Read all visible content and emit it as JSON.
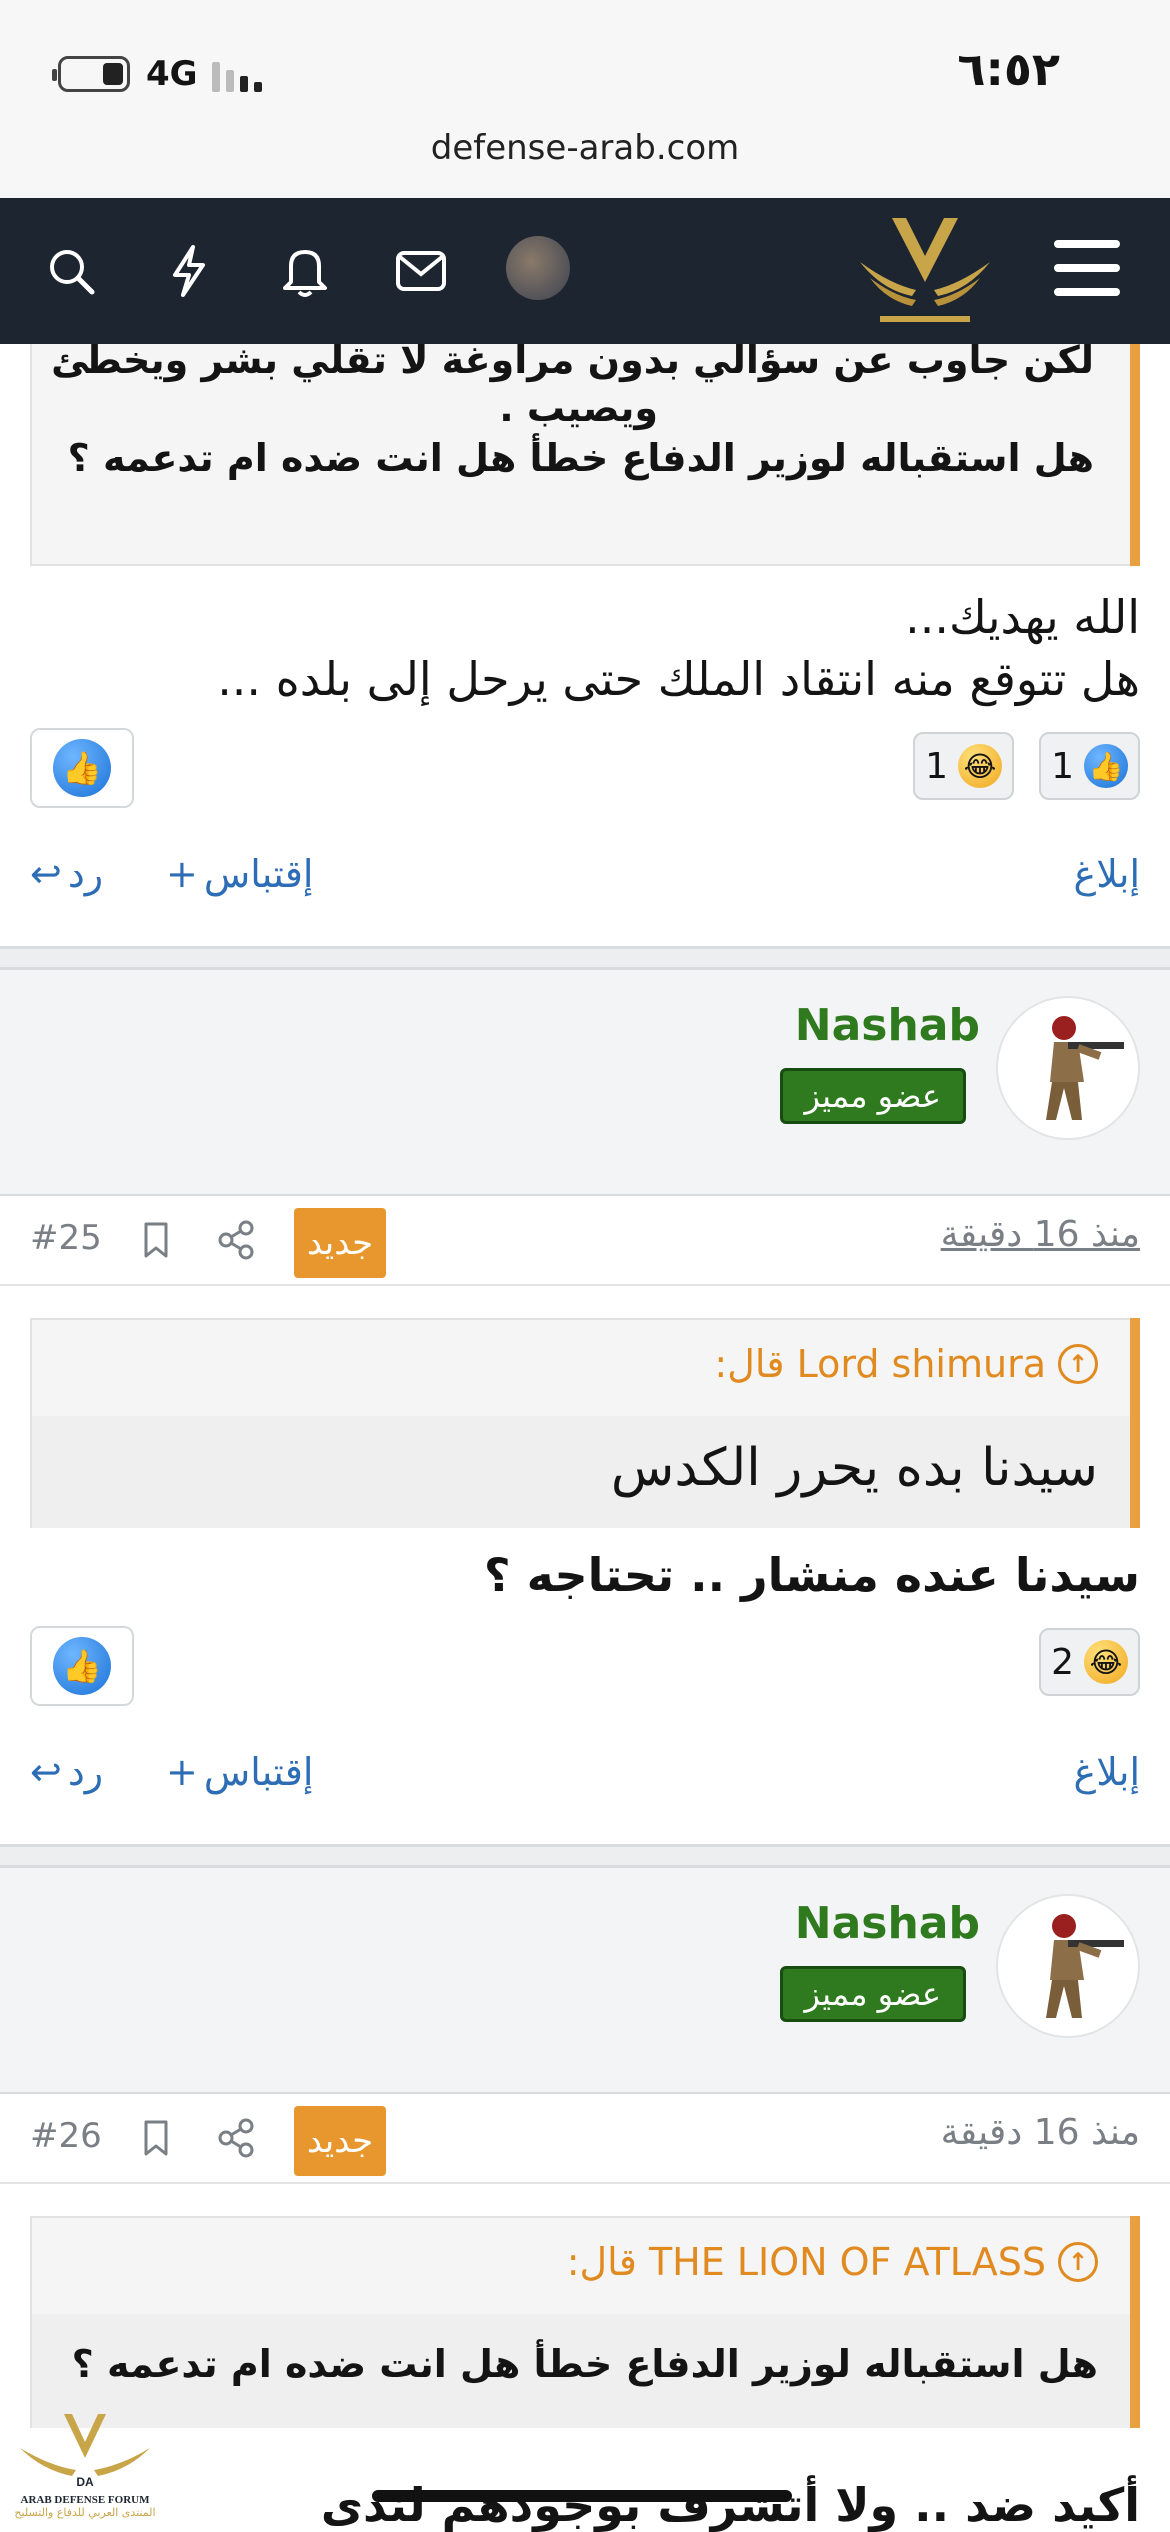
{
  "status": {
    "time": "٦:٥٢",
    "network": "4G"
  },
  "browser": {
    "url": "defense-arab.com"
  },
  "top_quote": {
    "line1": "لكن جاوب عن سؤالي بدون مراوغة لا تقلي بشر ويخطئ",
    "line2": "ويصيب .",
    "line3": "هل استقباله لوزير الدفاع خطأ هل انت ضده ام تدعمه ؟"
  },
  "post1": {
    "body_line1": "الله يهديك...",
    "body_line2": "هل تتوقع منه انتقاد الملك حتى يرحل إلى بلده ...",
    "reactions": [
      {
        "type": "like",
        "count": "1"
      },
      {
        "type": "laugh",
        "count": "1"
      }
    ],
    "actions": {
      "report": "إبلاغ",
      "quote": "إقتباس",
      "reply": "رد"
    }
  },
  "post2": {
    "username": "Nashab",
    "badge": "عضو مميز",
    "time_ago": "منذ 16 دقيقة",
    "new_label": "جديد",
    "number": "#25",
    "quote_author": "Lord shimura قال:",
    "quote_text": "سيدنا بده يحرر الكدس",
    "body": "سيدنا عنده منشار .. تحتاجه ؟",
    "reactions": [
      {
        "type": "laugh",
        "count": "2"
      }
    ],
    "actions": {
      "report": "إبلاغ",
      "quote": "إقتباس",
      "reply": "رد"
    }
  },
  "post3": {
    "username": "Nashab",
    "badge": "عضو مميز",
    "time_ago": "منذ 16 دقيقة",
    "new_label": "جديد",
    "number": "#26",
    "quote_author": "THE LION OF ATLASS قال:",
    "quote_text": "هل استقباله لوزير الدفاع خطأ هل انت ضده ام تدعمه ؟",
    "body_partial": "أكيد ضد .. ولا أتشرف بوجودهم لندى"
  },
  "footer_logo": {
    "line1": "ARAB DEFENSE FORUM",
    "line2": "المنتدى العربي للدفاع والتسليح"
  },
  "colors": {
    "accent_orange": "#e8962e",
    "link_blue": "#2d6db5",
    "user_green": "#2f7a1f",
    "nav_dark": "#1d2530"
  }
}
